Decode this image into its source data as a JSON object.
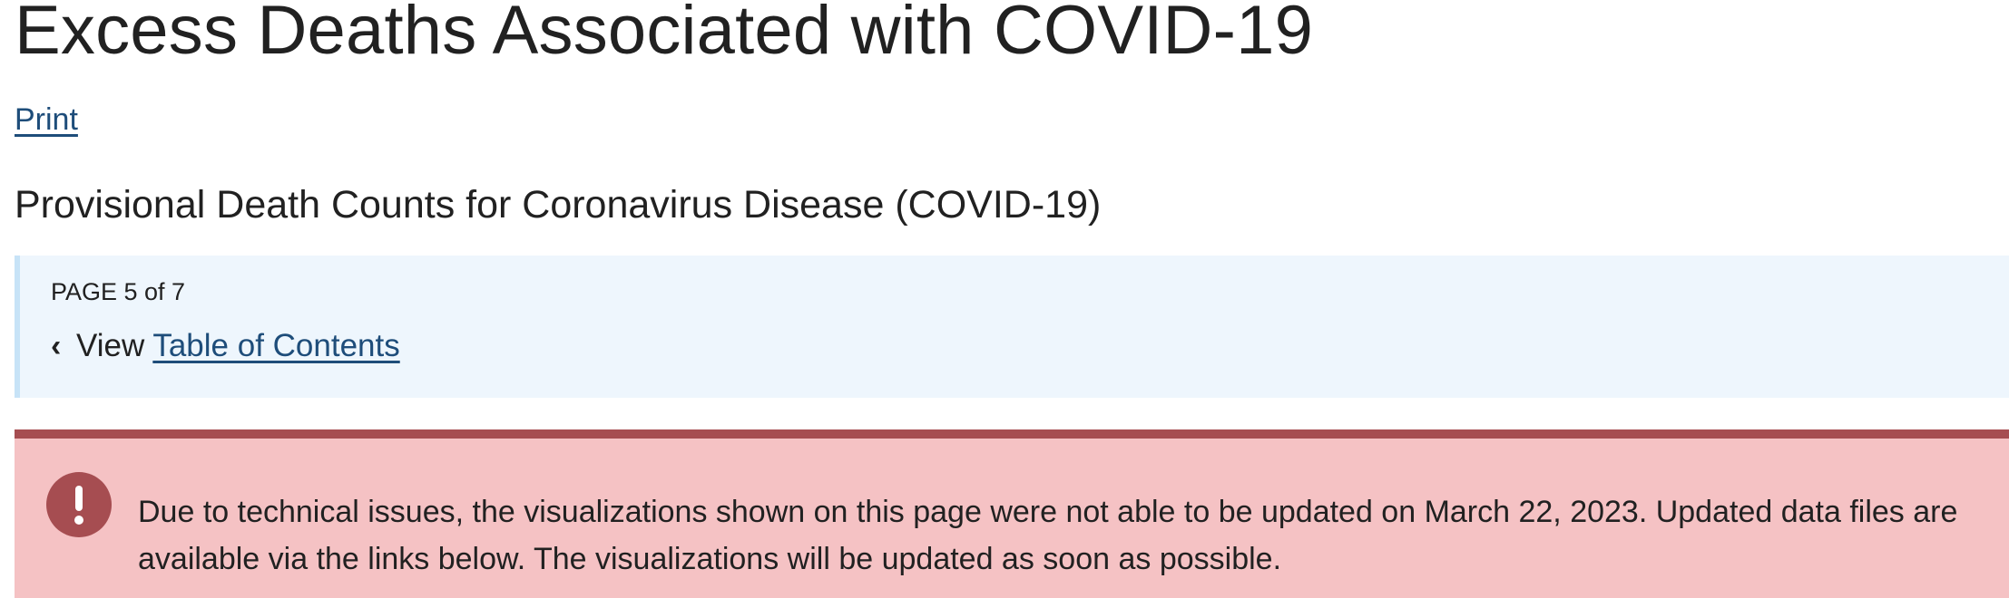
{
  "header": {
    "title": "Excess Deaths Associated with COVID-19",
    "print_label": "Print",
    "subtitle": "Provisional Death Counts for Coronavirus Disease (COVID-19)"
  },
  "pager": {
    "page_indicator": "PAGE 5 of 7",
    "view_prefix": "View",
    "toc_link_label": "Table of Contents",
    "chevron_icon": "chevron-left-icon"
  },
  "alert": {
    "icon": "exclamation-icon",
    "message": "Due to technical issues, the visualizations shown on this page were not able to be updated on March 22, 2023. Updated data files are available via the links below. The visualizations will be updated as soon as possible."
  },
  "colors": {
    "link": "#1e4d7a",
    "pager_background": "#eef6fd",
    "pager_border": "#c7e3f7",
    "alert_background": "#f5c2c4",
    "alert_accent": "#a64d51",
    "text": "#212121"
  }
}
